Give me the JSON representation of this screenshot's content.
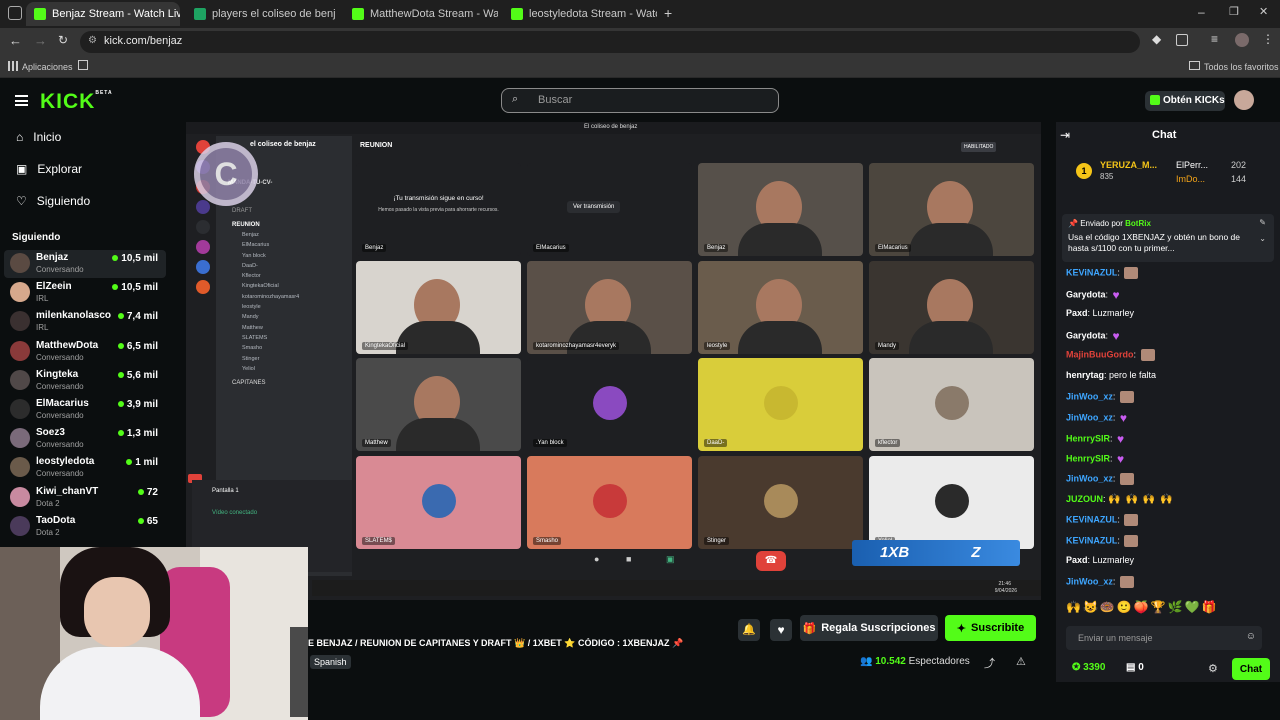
{
  "browser": {
    "tabs": [
      {
        "label": "Benjaz Stream - Watch Live"
      },
      {
        "label": "players el coliseo de benjaz - H"
      },
      {
        "label": "MatthewDota Stream - Watch L"
      },
      {
        "label": "leostyledota Stream - Watch Li"
      }
    ],
    "url": "kick.com/benjaz",
    "bookmark_apps": "Aplicaciones",
    "bookmark_all": "Todos los favoritos"
  },
  "header": {
    "logo": "KICK",
    "beta": "BETA",
    "search_placeholder": "Buscar",
    "get_kicks": "Obtén KICKs"
  },
  "sidebar": {
    "nav": [
      {
        "label": "Inicio",
        "icon": "home-icon"
      },
      {
        "label": "Explorar",
        "icon": "compass-icon"
      },
      {
        "label": "Siguiendo",
        "icon": "heart-icon"
      }
    ],
    "following_title": "Siguiendo",
    "channels": [
      {
        "name": "Benjaz",
        "category": "Conversando",
        "viewers": "10,5 mil"
      },
      {
        "name": "ElZeein",
        "category": "IRL",
        "viewers": "10,5 mil"
      },
      {
        "name": "milenkanolasco",
        "category": "IRL",
        "viewers": "7,4 mil"
      },
      {
        "name": "MatthewDota",
        "category": "Conversando",
        "viewers": "6,5 mil"
      },
      {
        "name": "Kingteka",
        "category": "Conversando",
        "viewers": "5,6 mil"
      },
      {
        "name": "ElMacarius",
        "category": "Conversando",
        "viewers": "3,9 mil"
      },
      {
        "name": "Soez3",
        "category": "Conversando",
        "viewers": "1,3 mil"
      },
      {
        "name": "leostyledota",
        "category": "Conversando",
        "viewers": "1 mil"
      },
      {
        "name": "Kiwi_chanVT",
        "category": "Dota 2",
        "viewers": "72"
      },
      {
        "name": "TaoDota",
        "category": "Dota 2",
        "viewers": "65"
      }
    ]
  },
  "video": {
    "discord_title": "El coliseo de benjaz",
    "server": "el coliseo de benjaz",
    "channel": "REUNION",
    "hidden_msg_title": "¡Tu transmisión sigue en curso!",
    "hidden_msg_body": "Hemos pasado la vista previa para ahorrarte recursos.",
    "ver_transmision": "Ver transmisión",
    "enabled": "HABILITADO",
    "panel": {
      "categories": [
        "MANDA-TU-CV-",
        "DRAFT",
        "REUNION",
        "CAPITANES"
      ],
      "members": [
        "Benjaz",
        "ElMacarius",
        "Yan block",
        "DaaD-",
        "Kflector",
        "KingtekaOficial",
        "kotarominozhayamasr4",
        "leostyle",
        "Mandy",
        "Matthew",
        "SLATEMS",
        "Smasho",
        "Stinger",
        "Yeliol"
      ],
      "screen": "Pantalla 1",
      "video_connected": "Vídeo conectado"
    },
    "tiles": [
      {
        "label": "Benjaz"
      },
      {
        "label": "ElMacarius"
      },
      {
        "label": "Benjaz"
      },
      {
        "label": "ElMacarius"
      },
      {
        "label": "KingtekaOficial"
      },
      {
        "label": "kotarominozhayamasr4everyk"
      },
      {
        "label": "leostyle"
      },
      {
        "label": "Mandy"
      },
      {
        "label": "Matthew"
      },
      {
        "label": ".Yan block"
      },
      {
        "label": "DaaD-"
      },
      {
        "label": "kflector"
      },
      {
        "label": "SLATEM$"
      },
      {
        "label": "Smasho"
      },
      {
        "label": "Stinger"
      },
      {
        "label": "Yeliol"
      }
    ],
    "overlay_banner": "1XB",
    "overlay_z": "Z",
    "clock": "21:46",
    "date": "9/04/2026"
  },
  "stream": {
    "title": "E BENJAZ / REUNION DE CAPITANES Y DRAFT 👑 / 1XBET ⭐ CÓDIGO : 1XBENJAZ 📌",
    "language": "Spanish",
    "viewers": "10.542",
    "viewers_label": "Espectadores",
    "gift_label": "Regala Suscripciones",
    "subscribe_label": "Suscribite"
  },
  "chat": {
    "title": "Chat",
    "leaderboard": [
      {
        "rank": "1",
        "name": "YERUZA_M...",
        "value": "835"
      },
      {
        "name": "ElPerr...",
        "value": "202"
      },
      {
        "name": "ImDo...",
        "value": "144"
      }
    ],
    "pinned_by": "Enviado por",
    "pinned_user": "BotRix",
    "pinned_text": "Usa el código 1XBENJAZ y obtén un bono de hasta s/1100 con tu primer...",
    "messages": [
      {
        "user": "KEViNAZUL",
        "text": "",
        "color": "#3ea6ff",
        "emote": "face"
      },
      {
        "user": "Garydota",
        "text": "",
        "color": "#ffffff",
        "emote": "heart"
      },
      {
        "user": "Paxd",
        "text": "Luzmarley",
        "color": "#ffffff",
        "emote": ""
      },
      {
        "user": "Garydota",
        "text": "",
        "color": "#ffffff",
        "emote": "heart"
      },
      {
        "user": "MajinBuuGordo",
        "text": "",
        "color": "#e0423a",
        "emote": "face"
      },
      {
        "user": "henrytag",
        "text": "pero le falta",
        "color": "#ffffff",
        "emote": ""
      },
      {
        "user": "JinWoo_xz",
        "text": "",
        "color": "#3ea6ff",
        "emote": "face"
      },
      {
        "user": "JinWoo_xz",
        "text": "",
        "color": "#3ea6ff",
        "emote": "heart"
      },
      {
        "user": "HenrrySIR",
        "text": "",
        "color": "#53fc18",
        "emote": "heart"
      },
      {
        "user": "HenrrySIR",
        "text": "",
        "color": "#53fc18",
        "emote": "heart"
      },
      {
        "user": "JinWoo_xz",
        "text": "",
        "color": "#3ea6ff",
        "emote": "face"
      },
      {
        "user": "JUZOUN",
        "text": "",
        "color": "#53fc18",
        "emote": "hands"
      },
      {
        "user": "KEViNAZUL",
        "text": "",
        "color": "#3ea6ff",
        "emote": "face"
      },
      {
        "user": "KEViNAZUL",
        "text": "",
        "color": "#3ea6ff",
        "emote": "face"
      },
      {
        "user": "Paxd",
        "text": "Luzmarley",
        "color": "#ffffff",
        "emote": ""
      },
      {
        "user": "JinWoo_xz",
        "text": "",
        "color": "#3ea6ff",
        "emote": "face"
      }
    ],
    "input_placeholder": "Enviar un mensaje",
    "points": "3390",
    "count": "0",
    "send_label": "Chat"
  },
  "colors": {
    "brand": "#53fc18",
    "bg": "#0b0e0f",
    "chat_bg": "#191b1f"
  }
}
